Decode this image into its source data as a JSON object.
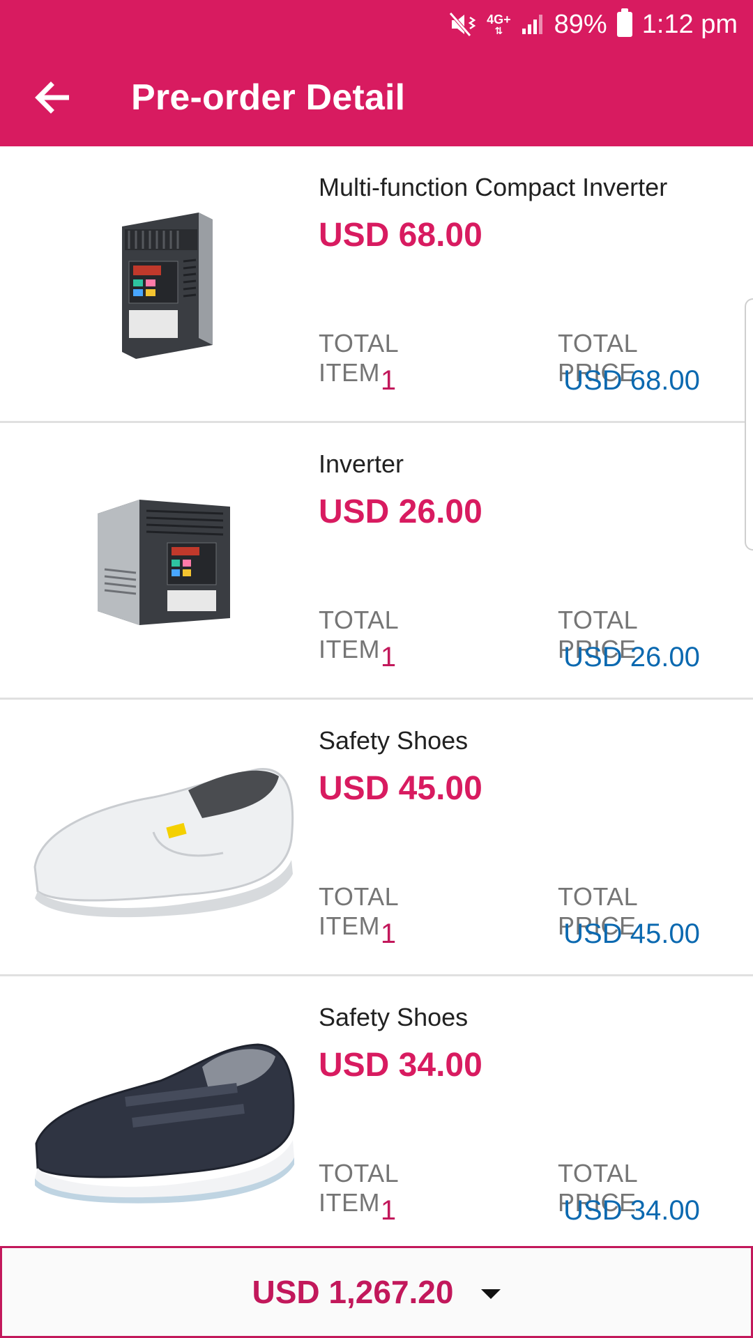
{
  "status_bar": {
    "mute_icon": "mute-vibrate-icon",
    "network": "4G+",
    "signal_icon": "signal-icon",
    "battery": "89%",
    "time": "1:12 pm"
  },
  "toolbar": {
    "back_icon": "arrow-left-icon",
    "title": "Pre-order Detail"
  },
  "labels": {
    "total_item": "TOTAL ITEM",
    "total_price": "TOTAL PRICE"
  },
  "items": [
    {
      "name": "Multi-function Compact Inverter",
      "price": "USD 68.00",
      "total_item": "1",
      "total_price": "USD 68.00",
      "image": "inverter-image"
    },
    {
      "name": "Inverter",
      "price": "USD 26.00",
      "total_item": "1",
      "total_price": "USD 26.00",
      "image": "inverter-image"
    },
    {
      "name": "Safety Shoes",
      "price": "USD 45.00",
      "total_item": "1",
      "total_price": "USD 45.00",
      "image": "white-shoe-image"
    },
    {
      "name": "Safety Shoes",
      "price": "USD 34.00",
      "total_item": "1",
      "total_price": "USD 34.00",
      "image": "navy-shoe-image"
    }
  ],
  "footer": {
    "total": "USD 1,267.20",
    "toggle_icon": "caret-down-icon"
  },
  "colors": {
    "accent": "#d81b60",
    "price_blue": "#0b69b0",
    "label_gray": "#757575"
  }
}
